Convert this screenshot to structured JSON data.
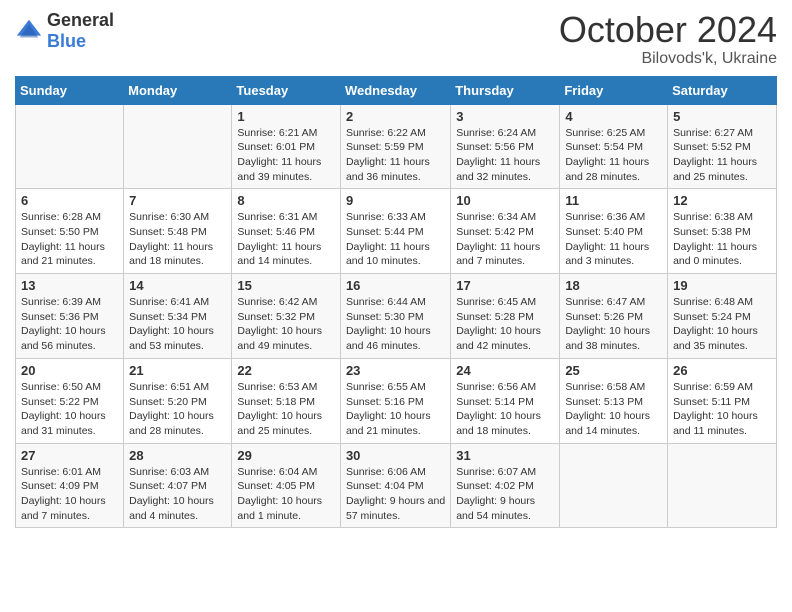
{
  "logo": {
    "text_general": "General",
    "text_blue": "Blue"
  },
  "header": {
    "month": "October 2024",
    "location": "Bilovods'k, Ukraine"
  },
  "days_of_week": [
    "Sunday",
    "Monday",
    "Tuesday",
    "Wednesday",
    "Thursday",
    "Friday",
    "Saturday"
  ],
  "weeks": [
    [
      {
        "day": "",
        "info": ""
      },
      {
        "day": "",
        "info": ""
      },
      {
        "day": "1",
        "info": "Sunrise: 6:21 AM\nSunset: 6:01 PM\nDaylight: 11 hours and 39 minutes."
      },
      {
        "day": "2",
        "info": "Sunrise: 6:22 AM\nSunset: 5:59 PM\nDaylight: 11 hours and 36 minutes."
      },
      {
        "day": "3",
        "info": "Sunrise: 6:24 AM\nSunset: 5:56 PM\nDaylight: 11 hours and 32 minutes."
      },
      {
        "day": "4",
        "info": "Sunrise: 6:25 AM\nSunset: 5:54 PM\nDaylight: 11 hours and 28 minutes."
      },
      {
        "day": "5",
        "info": "Sunrise: 6:27 AM\nSunset: 5:52 PM\nDaylight: 11 hours and 25 minutes."
      }
    ],
    [
      {
        "day": "6",
        "info": "Sunrise: 6:28 AM\nSunset: 5:50 PM\nDaylight: 11 hours and 21 minutes."
      },
      {
        "day": "7",
        "info": "Sunrise: 6:30 AM\nSunset: 5:48 PM\nDaylight: 11 hours and 18 minutes."
      },
      {
        "day": "8",
        "info": "Sunrise: 6:31 AM\nSunset: 5:46 PM\nDaylight: 11 hours and 14 minutes."
      },
      {
        "day": "9",
        "info": "Sunrise: 6:33 AM\nSunset: 5:44 PM\nDaylight: 11 hours and 10 minutes."
      },
      {
        "day": "10",
        "info": "Sunrise: 6:34 AM\nSunset: 5:42 PM\nDaylight: 11 hours and 7 minutes."
      },
      {
        "day": "11",
        "info": "Sunrise: 6:36 AM\nSunset: 5:40 PM\nDaylight: 11 hours and 3 minutes."
      },
      {
        "day": "12",
        "info": "Sunrise: 6:38 AM\nSunset: 5:38 PM\nDaylight: 11 hours and 0 minutes."
      }
    ],
    [
      {
        "day": "13",
        "info": "Sunrise: 6:39 AM\nSunset: 5:36 PM\nDaylight: 10 hours and 56 minutes."
      },
      {
        "day": "14",
        "info": "Sunrise: 6:41 AM\nSunset: 5:34 PM\nDaylight: 10 hours and 53 minutes."
      },
      {
        "day": "15",
        "info": "Sunrise: 6:42 AM\nSunset: 5:32 PM\nDaylight: 10 hours and 49 minutes."
      },
      {
        "day": "16",
        "info": "Sunrise: 6:44 AM\nSunset: 5:30 PM\nDaylight: 10 hours and 46 minutes."
      },
      {
        "day": "17",
        "info": "Sunrise: 6:45 AM\nSunset: 5:28 PM\nDaylight: 10 hours and 42 minutes."
      },
      {
        "day": "18",
        "info": "Sunrise: 6:47 AM\nSunset: 5:26 PM\nDaylight: 10 hours and 38 minutes."
      },
      {
        "day": "19",
        "info": "Sunrise: 6:48 AM\nSunset: 5:24 PM\nDaylight: 10 hours and 35 minutes."
      }
    ],
    [
      {
        "day": "20",
        "info": "Sunrise: 6:50 AM\nSunset: 5:22 PM\nDaylight: 10 hours and 31 minutes."
      },
      {
        "day": "21",
        "info": "Sunrise: 6:51 AM\nSunset: 5:20 PM\nDaylight: 10 hours and 28 minutes."
      },
      {
        "day": "22",
        "info": "Sunrise: 6:53 AM\nSunset: 5:18 PM\nDaylight: 10 hours and 25 minutes."
      },
      {
        "day": "23",
        "info": "Sunrise: 6:55 AM\nSunset: 5:16 PM\nDaylight: 10 hours and 21 minutes."
      },
      {
        "day": "24",
        "info": "Sunrise: 6:56 AM\nSunset: 5:14 PM\nDaylight: 10 hours and 18 minutes."
      },
      {
        "day": "25",
        "info": "Sunrise: 6:58 AM\nSunset: 5:13 PM\nDaylight: 10 hours and 14 minutes."
      },
      {
        "day": "26",
        "info": "Sunrise: 6:59 AM\nSunset: 5:11 PM\nDaylight: 10 hours and 11 minutes."
      }
    ],
    [
      {
        "day": "27",
        "info": "Sunrise: 6:01 AM\nSunset: 4:09 PM\nDaylight: 10 hours and 7 minutes."
      },
      {
        "day": "28",
        "info": "Sunrise: 6:03 AM\nSunset: 4:07 PM\nDaylight: 10 hours and 4 minutes."
      },
      {
        "day": "29",
        "info": "Sunrise: 6:04 AM\nSunset: 4:05 PM\nDaylight: 10 hours and 1 minute."
      },
      {
        "day": "30",
        "info": "Sunrise: 6:06 AM\nSunset: 4:04 PM\nDaylight: 9 hours and 57 minutes."
      },
      {
        "day": "31",
        "info": "Sunrise: 6:07 AM\nSunset: 4:02 PM\nDaylight: 9 hours and 54 minutes."
      },
      {
        "day": "",
        "info": ""
      },
      {
        "day": "",
        "info": ""
      }
    ]
  ]
}
